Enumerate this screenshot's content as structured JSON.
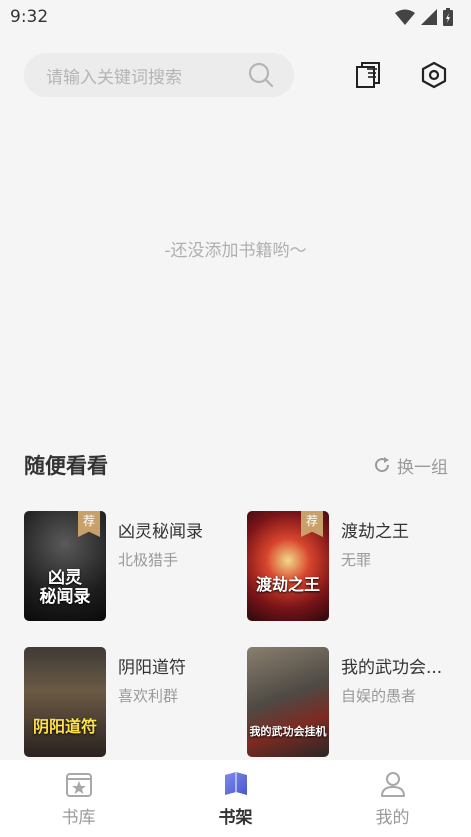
{
  "status_bar": {
    "time": "9:32"
  },
  "search": {
    "placeholder": "请输入关键词搜索"
  },
  "toolbar": {
    "manage_icon": "book-manage-icon",
    "settings_icon": "settings-hex-icon"
  },
  "empty_shelf": {
    "message": "-还没添加书籍哟～"
  },
  "recommend": {
    "title": "随便看看",
    "refresh_label": "换一组",
    "books": [
      {
        "name": "凶灵秘闻录",
        "author": "北极猎手",
        "badge": "荐",
        "cover_title": "凶灵\n秘闻录"
      },
      {
        "name": "渡劫之王",
        "author": "无罪",
        "badge": "荐",
        "cover_title": "渡劫之王"
      },
      {
        "name": "阴阳道符",
        "author": "喜欢利群",
        "badge": "",
        "cover_title": "阴阳道符"
      },
      {
        "name": "我的武功会...",
        "author": "自娱的愚者",
        "badge": "",
        "cover_title": "我的武功会挂机"
      }
    ]
  },
  "nav": {
    "items": [
      {
        "label": "书库",
        "icon": "library-icon"
      },
      {
        "label": "书架",
        "icon": "bookshelf-icon"
      },
      {
        "label": "我的",
        "icon": "profile-icon"
      }
    ]
  },
  "colors": {
    "accent": "#5b6bd8",
    "background": "#f5f5f5",
    "badge": "#c9a06a"
  }
}
